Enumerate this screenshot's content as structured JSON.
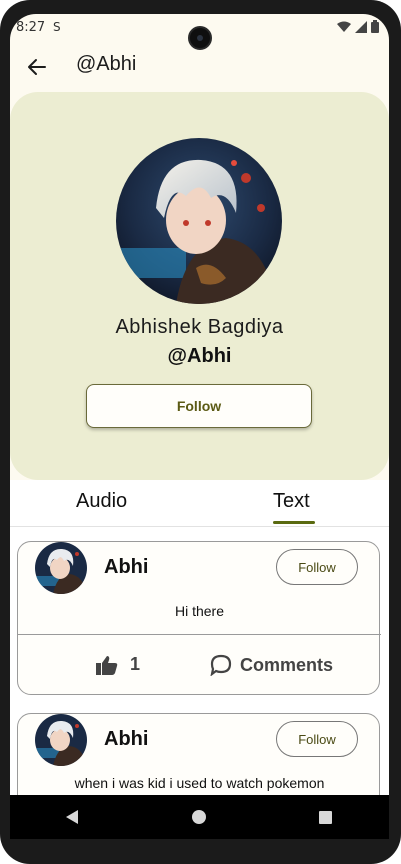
{
  "status_bar": {
    "time": "8:27",
    "extra_icon": "S"
  },
  "app_bar": {
    "back_icon": "arrow-left",
    "title": "@Abhi"
  },
  "profile": {
    "full_name": "Abhishek Bagdiya",
    "handle": "@Abhi",
    "follow_label": "Follow",
    "card_color": "#ecedd2"
  },
  "tabs": [
    {
      "label": "Audio",
      "selected": false
    },
    {
      "label": "Text",
      "selected": true
    }
  ],
  "posts": [
    {
      "author": "Abhi",
      "follow_label": "Follow",
      "text": "Hi there",
      "likes": "1",
      "comments_label": "Comments"
    },
    {
      "author": "Abhi",
      "follow_label": "Follow",
      "text": "when i was kid i used to watch pokemon"
    }
  ],
  "nav": {
    "back": "triangle-back",
    "home": "circle-home",
    "recents": "square-recents"
  },
  "colors": {
    "accent": "#5a6a10",
    "follow_text": "#5b5a14",
    "background": "#fdfaf0"
  }
}
